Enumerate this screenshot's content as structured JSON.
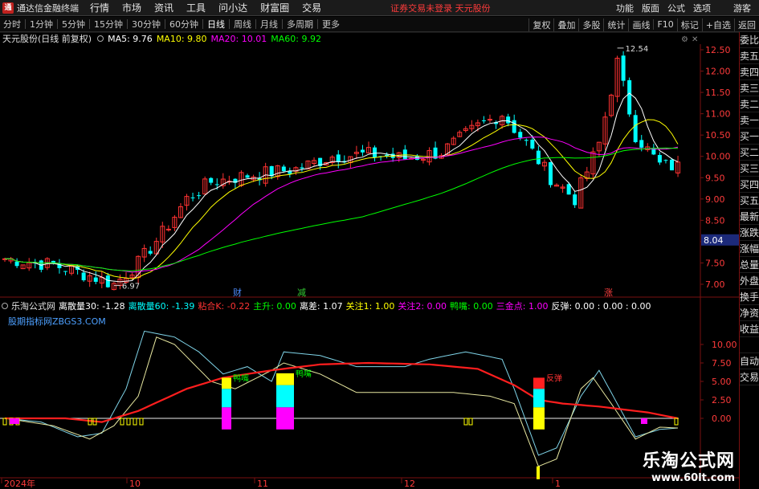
{
  "menubar": {
    "app_name": "通达信金融终端",
    "items": [
      "行情",
      "市场",
      "资讯",
      "工具",
      "问小达",
      "财富圈",
      "交易"
    ],
    "notice": "证券交易未登录  天元股份",
    "right_items": [
      "功能",
      "版面",
      "公式",
      "选项"
    ],
    "guest": "游客"
  },
  "periods": [
    "分时",
    "1分钟",
    "5分钟",
    "15分钟",
    "30分钟",
    "60分钟",
    "日线",
    "周线",
    "月线",
    "多周期",
    "更多"
  ],
  "active_period": "日线",
  "toolbar": [
    "复权",
    "叠加",
    "多股",
    "统计",
    "画线",
    "F10",
    "标记",
    "+自选",
    "返回"
  ],
  "sidebar": [
    "委比",
    "卖五",
    "卖四",
    "卖三",
    "卖二",
    "卖一",
    "买一",
    "买二",
    "买三",
    "买四",
    "买五",
    "最新",
    "涨跌",
    "涨幅",
    "总量",
    "外盘",
    "换手",
    "净资",
    "收益",
    "",
    "自动",
    "交易"
  ],
  "kline": {
    "title": "天元股份(日线 前复权)",
    "ma": [
      {
        "label": "MA5: 9.76",
        "color": "#ffffff"
      },
      {
        "label": "MA10: 9.80",
        "color": "#ffff00"
      },
      {
        "label": "MA20: 10.01",
        "color": "#ff00ff"
      },
      {
        "label": "MA60: 9.92",
        "color": "#00ff00"
      }
    ],
    "high_label": "12.54",
    "low_label": "6.97",
    "current_price": "8.04",
    "y_axis": [
      "12.50",
      "12.00",
      "11.50",
      "11.00",
      "10.50",
      "10.00",
      "9.50",
      "9.00",
      "8.50",
      "8.00",
      "7.50",
      "7.00"
    ],
    "markers": [
      {
        "text": "财",
        "color": "#4d8cff"
      },
      {
        "text": "减",
        "color": "#33cc33"
      },
      {
        "text": "涨",
        "color": "#ff4040"
      }
    ]
  },
  "indicator": {
    "name": "乐淘公式网",
    "values": [
      {
        "label": "离散量30: -1.28",
        "color": "#ffffff"
      },
      {
        "label": "离散量60: -1.39",
        "color": "#00ffff"
      },
      {
        "label": "粘合K: -0.22",
        "color": "#ff3333"
      },
      {
        "label": "主升: 0.00",
        "color": "#00ff00"
      },
      {
        "label": "离差: 1.07",
        "color": "#ffffff"
      },
      {
        "label": "关注1: 1.00",
        "color": "#ffff00"
      },
      {
        "label": "关注2: 0.00",
        "color": "#ff00ff"
      },
      {
        "label": "鸭嘴: 0.00",
        "color": "#00ff00"
      },
      {
        "label": "三金点: 1.00",
        "color": "#ff00ff"
      },
      {
        "label": "反弹: 0.00 : 0.00 : 0.00",
        "color": "#ffffff"
      }
    ],
    "subtitle": "股期指标网ZBGS3.COM",
    "y_axis": [
      "10.00",
      "7.50",
      "5.00",
      "2.50",
      "0.00"
    ],
    "signals": [
      "鸭嘴",
      "鸭嘴",
      "反弹"
    ]
  },
  "x_axis": [
    "2024年",
    "10",
    "11",
    "12",
    "1"
  ],
  "watermark": {
    "line1": "乐淘公式网",
    "line2": "www.60lt.com"
  },
  "colors": {
    "up": "#ff3232",
    "down": "#00ffff",
    "ma5": "#ffffff",
    "ma10": "#ffff00",
    "ma20": "#ff00ff",
    "ma60": "#00ff00"
  }
}
